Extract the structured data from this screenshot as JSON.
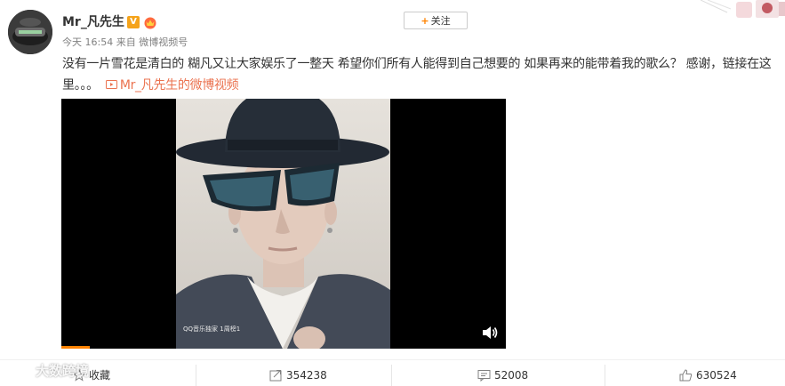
{
  "post": {
    "username": "Mr_凡先生",
    "verified_badge": "V",
    "meta": "今天 16:54 来自 微博视频号",
    "follow_label": "关注",
    "follow_plus": "+",
    "text": "没有一片雪花是清白的 糊凡又让大家娱乐了一整天 希望你们所有人能得到自己想要的 如果再来的能带着我的歌么？ 感谢，链接在这里。。。",
    "video_link_label": "Mr_凡先生的微博视频"
  },
  "video": {
    "caption": "QQ音乐独家 1周榜1"
  },
  "actions": {
    "favorite_label": "收藏",
    "repost_count": "354238",
    "comment_count": "52008",
    "like_count": "630524"
  },
  "watermark": {
    "text": "大数跨境"
  },
  "colors": {
    "accent_orange": "#ff8200",
    "link_orange": "#eb7350",
    "verified": "#f5a31a",
    "meta_gray": "#808080"
  },
  "icons": {
    "video_link": "video-icon",
    "favorite": "star-icon",
    "repost": "repost-icon",
    "comment": "comment-icon",
    "like": "thumbs-up-icon",
    "volume": "volume-icon"
  }
}
